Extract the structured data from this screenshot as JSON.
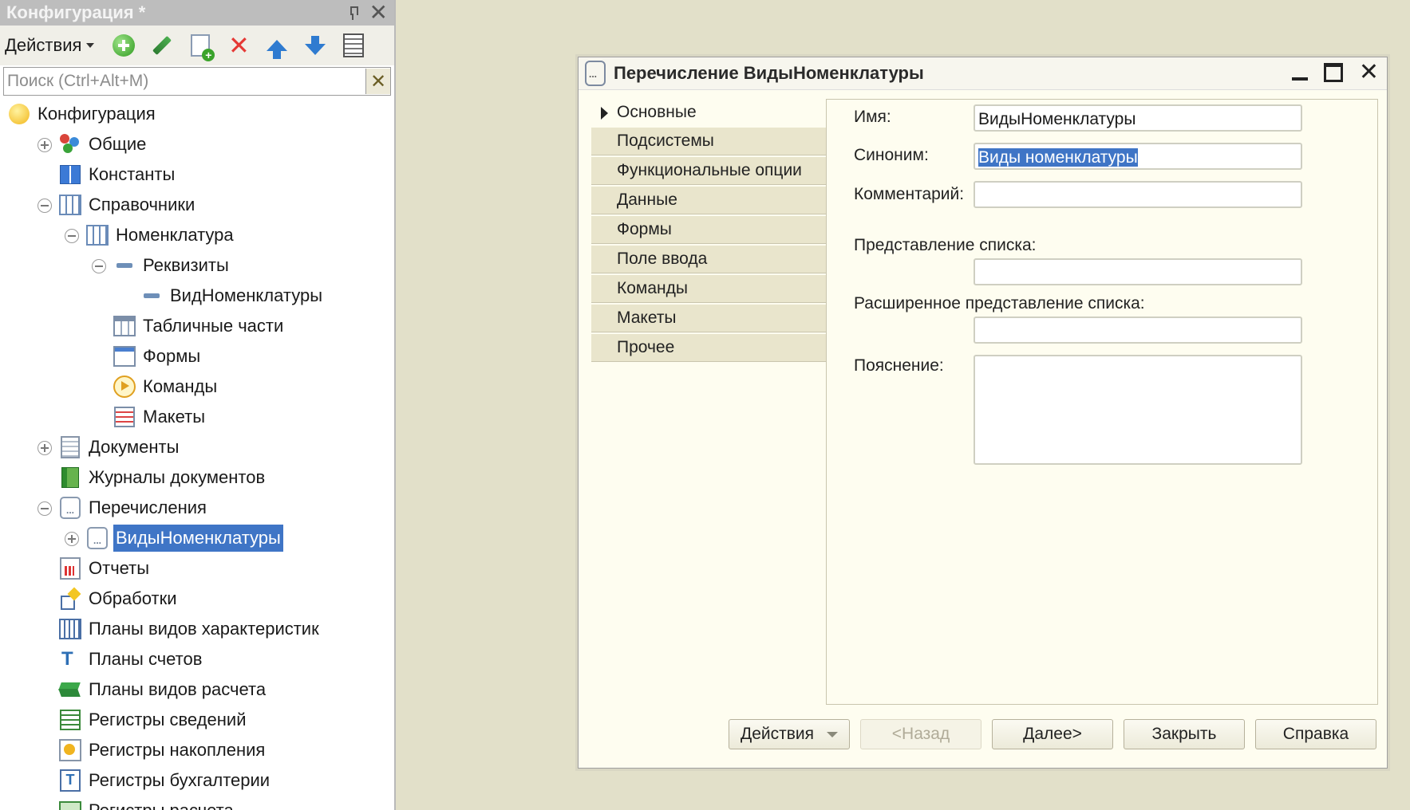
{
  "config_panel": {
    "title": "Конфигурация *",
    "toolbar": {
      "actions_label": "Действия"
    },
    "search": {
      "placeholder": "Поиск (Ctrl+Alt+M)"
    },
    "tree": [
      {
        "label": "Конфигурация",
        "icon": "configuration-icon",
        "level": 0,
        "expander": "none"
      },
      {
        "label": "Общие",
        "icon": "common-icon",
        "level": 1,
        "expander": "plus"
      },
      {
        "label": "Константы",
        "icon": "constants-icon",
        "level": 1,
        "expander": "none"
      },
      {
        "label": "Справочники",
        "icon": "catalogs-icon",
        "level": 1,
        "expander": "minus"
      },
      {
        "label": "Номенклатура",
        "icon": "catalog-icon",
        "level": 2,
        "expander": "minus"
      },
      {
        "label": "Реквизиты",
        "icon": "attributes-icon",
        "level": 3,
        "expander": "minus"
      },
      {
        "label": "ВидНоменклатуры",
        "icon": "attribute-icon",
        "level": 4,
        "expander": "none"
      },
      {
        "label": "Табличные части",
        "icon": "tabular-sections-icon",
        "level": 3,
        "expander": "none"
      },
      {
        "label": "Формы",
        "icon": "forms-icon",
        "level": 3,
        "expander": "none"
      },
      {
        "label": "Команды",
        "icon": "commands-icon",
        "level": 3,
        "expander": "none"
      },
      {
        "label": "Макеты",
        "icon": "templates-icon",
        "level": 3,
        "expander": "none"
      },
      {
        "label": "Документы",
        "icon": "documents-icon",
        "level": 1,
        "expander": "plus"
      },
      {
        "label": "Журналы документов",
        "icon": "document-journals-icon",
        "level": 1,
        "expander": "none"
      },
      {
        "label": "Перечисления",
        "icon": "enumerations-icon",
        "level": 1,
        "expander": "minus"
      },
      {
        "label": "ВидыНоменклатуры",
        "icon": "enumeration-icon",
        "level": 2,
        "expander": "plus",
        "selected": true
      },
      {
        "label": "Отчеты",
        "icon": "reports-icon",
        "level": 1,
        "expander": "none"
      },
      {
        "label": "Обработки",
        "icon": "data-processors-icon",
        "level": 1,
        "expander": "none"
      },
      {
        "label": "Планы видов характеристик",
        "icon": "chart-of-characteristic-types-icon",
        "level": 1,
        "expander": "none"
      },
      {
        "label": "Планы счетов",
        "icon": "chart-of-accounts-icon",
        "level": 1,
        "expander": "none"
      },
      {
        "label": "Планы видов расчета",
        "icon": "chart-of-calculation-types-icon",
        "level": 1,
        "expander": "none"
      },
      {
        "label": "Регистры сведений",
        "icon": "information-registers-icon",
        "level": 1,
        "expander": "none"
      },
      {
        "label": "Регистры накопления",
        "icon": "accumulation-registers-icon",
        "level": 1,
        "expander": "none"
      },
      {
        "label": "Регистры бухгалтерии",
        "icon": "accounting-registers-icon",
        "level": 1,
        "expander": "none"
      },
      {
        "label": "Регистры расчета",
        "icon": "calculation-registers-icon",
        "level": 1,
        "expander": "none"
      }
    ]
  },
  "enum_window": {
    "title": "Перечисление ВидыНоменклатуры",
    "nav": [
      {
        "label": "Основные",
        "active": true
      },
      {
        "label": "Подсистемы"
      },
      {
        "label": "Функциональные опции"
      },
      {
        "label": "Данные"
      },
      {
        "label": "Формы"
      },
      {
        "label": "Поле ввода"
      },
      {
        "label": "Команды"
      },
      {
        "label": "Макеты"
      },
      {
        "label": "Прочее"
      }
    ],
    "fields": {
      "name_label": "Имя:",
      "name_value": "ВидыНоменклатуры",
      "synonym_label": "Синоним:",
      "synonym_value": "Виды номенклатуры",
      "comment_label": "Комментарий:",
      "comment_value": "",
      "list_presentation_label": "Представление списка:",
      "list_presentation_value": "",
      "ext_list_presentation_label": "Расширенное представление списка:",
      "ext_list_presentation_value": "",
      "explanation_label": "Пояснение:",
      "explanation_value": ""
    },
    "buttons": {
      "actions": "Действия",
      "back": "<Назад",
      "next": "Далее>",
      "close": "Закрыть",
      "help": "Справка"
    }
  }
}
